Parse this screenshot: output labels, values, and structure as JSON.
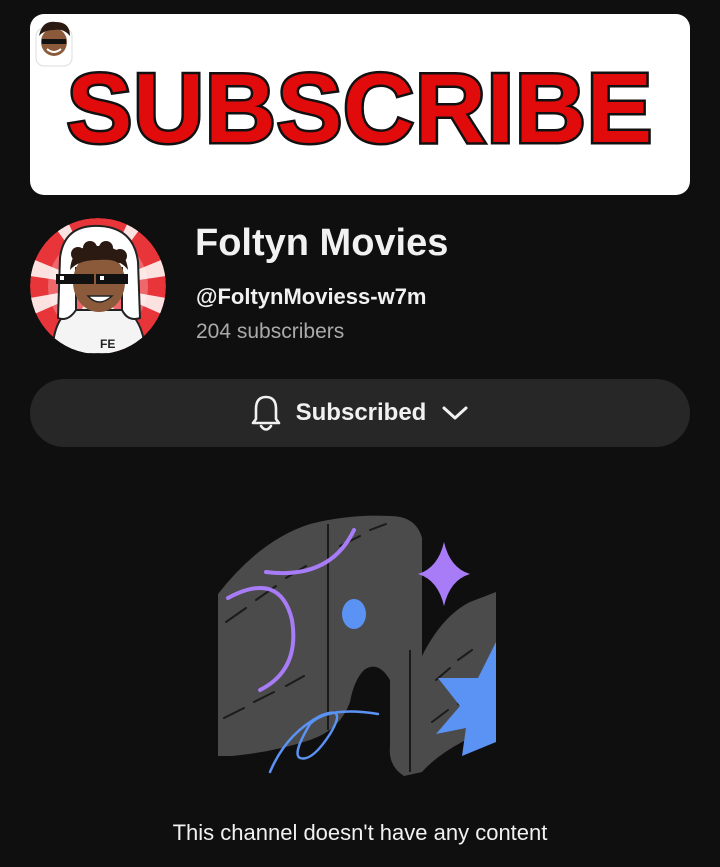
{
  "banner": {
    "text": "SUBSCRIBE",
    "text_color": "#e10b0b",
    "background": "#ffffff"
  },
  "channel": {
    "name": "Foltyn Movies",
    "handle": "@FoltynMoviess-w7m",
    "subscribers": "204 subscribers",
    "avatar_icon": "cartoon-avatar-with-sunglasses"
  },
  "subscribe_button": {
    "label": "Subscribed",
    "bell_icon": "bell-icon",
    "chevron_icon": "chevron-down-icon"
  },
  "empty_state": {
    "message": "This channel doesn't have any content",
    "illustration": "empty-channel-illustration"
  },
  "colors": {
    "background": "#0f0f0f",
    "button_bg": "#272727",
    "text_primary": "#f1f1f1",
    "text_secondary": "#aaaaaa",
    "accent_purple": "#a77cf6",
    "accent_blue": "#5b93f5"
  }
}
